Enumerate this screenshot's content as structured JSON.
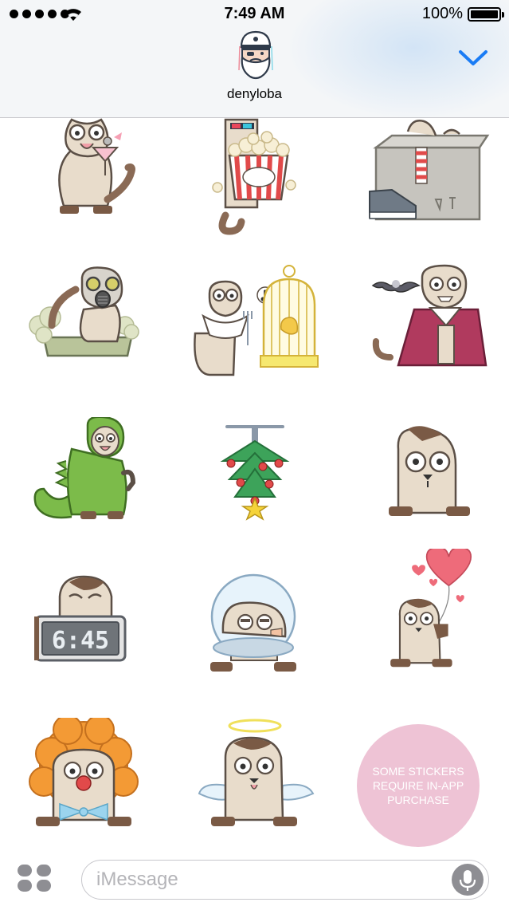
{
  "status_bar": {
    "time": "7:49 AM",
    "battery": "100%",
    "signal_dots": 5,
    "battery_level": 1.0
  },
  "header": {
    "contact_name": "denyloba",
    "avatar_icon": "bearded-sailor-avatar-icon",
    "collapse_icon": "chevron-down-icon",
    "accent_color": "#1a7cf5"
  },
  "stickers": [
    {
      "name": "cat-with-cocktail-sticker"
    },
    {
      "name": "cat-with-popcorn-sticker"
    },
    {
      "name": "cat-in-box-sticker"
    },
    {
      "name": "cat-gas-mask-litter-sticker"
    },
    {
      "name": "cat-with-birdcage-sticker"
    },
    {
      "name": "vampire-cat-sticker"
    },
    {
      "name": "dinosaur-costume-cat-sticker"
    },
    {
      "name": "christmas-tree-sticker"
    },
    {
      "name": "peeking-cat-sticker"
    },
    {
      "name": "alarm-clock-cat-sticker"
    },
    {
      "name": "space-helmet-cat-sticker"
    },
    {
      "name": "heart-balloon-cat-sticker"
    },
    {
      "name": "clown-cat-sticker"
    },
    {
      "name": "angel-cat-sticker"
    }
  ],
  "alarm_clock_display": "6:45",
  "purchase_badge": {
    "text": "SOME STICKERS REQUIRE IN-APP PURCHASE",
    "color": "#eec3d5"
  },
  "composer": {
    "placeholder": "iMessage",
    "apps_icon": "app-drawer-icon",
    "mic_icon": "microphone-icon"
  }
}
